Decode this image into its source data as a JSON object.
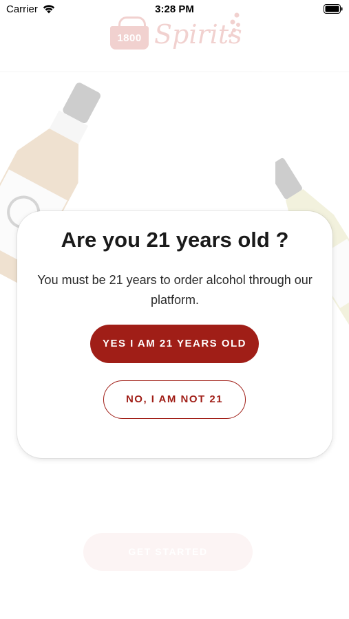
{
  "status_bar": {
    "carrier": "Carrier",
    "time": "3:28 PM",
    "icons": [
      "wifi-icon",
      "battery-icon"
    ]
  },
  "header": {
    "logo_badge_text": "1800",
    "logo_word": "Spirits"
  },
  "background": {
    "get_started_label": "GET STARTED"
  },
  "dialog": {
    "title": "Are you 21 years old ?",
    "message": "You must be 21 years to order alcohol through our platform.",
    "yes_label": "YES I AM 21 YEARS OLD",
    "no_label": "NO, I AM NOT 21"
  },
  "colors": {
    "accent": "#a01e17",
    "brand": "#c4322a",
    "dialog_bg": "#ffffff"
  }
}
